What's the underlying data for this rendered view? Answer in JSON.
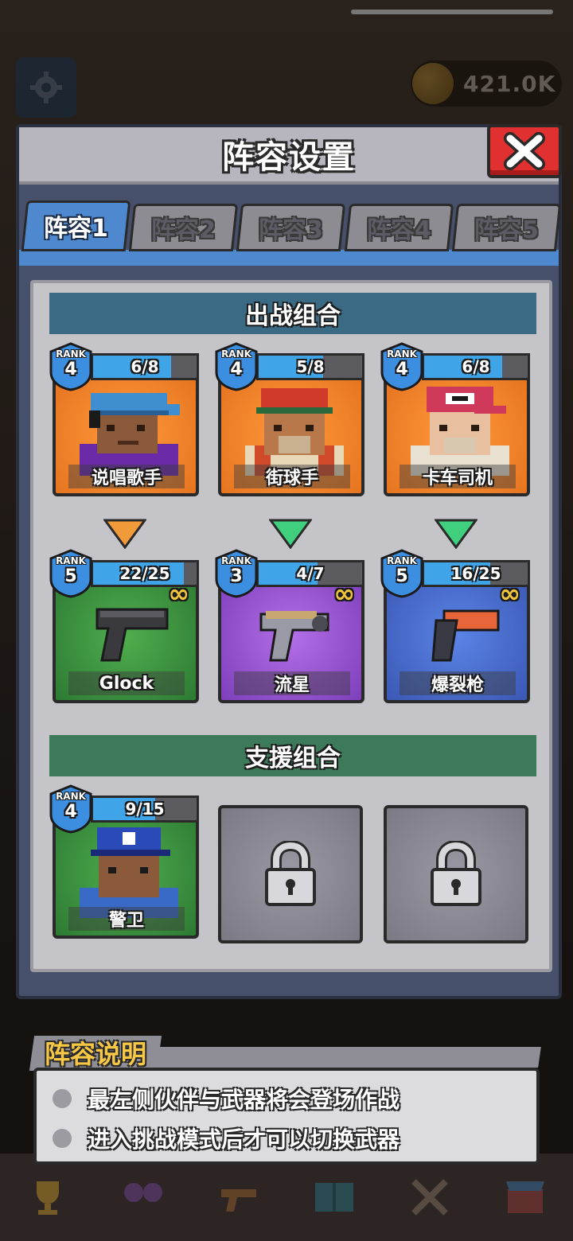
{
  "background": {
    "coin_amount": "421.0K"
  },
  "modal": {
    "title": "阵容设置",
    "tabs": [
      {
        "label": "阵容1",
        "active": true
      },
      {
        "label": "阵容2",
        "active": false
      },
      {
        "label": "阵容3",
        "active": false
      },
      {
        "label": "阵容4",
        "active": false
      },
      {
        "label": "阵容5",
        "active": false
      }
    ],
    "battle_section": {
      "title": "出战组合",
      "companions": [
        {
          "name": "说唱歌手",
          "rank_label": "RANK",
          "rank": "4",
          "progress": "6/8",
          "progress_fraction": 0.75,
          "color": "#e4711d"
        },
        {
          "name": "街球手",
          "rank_label": "RANK",
          "rank": "4",
          "progress": "5/8",
          "progress_fraction": 0.625,
          "color": "#e4711d"
        },
        {
          "name": "卡车司机",
          "rank_label": "RANK",
          "rank": "4",
          "progress": "6/8",
          "progress_fraction": 0.75,
          "color": "#e4711d"
        }
      ],
      "arrows": [
        {
          "color": "#f09a3a"
        },
        {
          "color": "#3fcf7d"
        },
        {
          "color": "#3fcf7d"
        }
      ],
      "weapons": [
        {
          "name": "Glock",
          "rank_label": "RANK",
          "rank": "5",
          "progress": "22/25",
          "progress_fraction": 0.88,
          "ammo": "∞",
          "color": "#2d7a33"
        },
        {
          "name": "流星",
          "rank_label": "RANK",
          "rank": "3",
          "progress": "4/7",
          "progress_fraction": 0.571,
          "ammo": "∞",
          "color": "#7e3fbb"
        },
        {
          "name": "爆裂枪",
          "rank_label": "RANK",
          "rank": "5",
          "progress": "16/25",
          "progress_fraction": 0.64,
          "ammo": "∞",
          "color": "#3b58b4"
        }
      ]
    },
    "support_section": {
      "title": "支援组合",
      "slots": [
        {
          "name": "警卫",
          "rank_label": "RANK",
          "rank": "4",
          "progress": "9/15",
          "progress_fraction": 0.6,
          "locked": false
        },
        {
          "locked": true
        },
        {
          "locked": true
        }
      ]
    }
  },
  "info": {
    "title": "阵容说明",
    "lines": [
      "最左侧伙伴与武器将会登场作战",
      "进入挑战模式后才可以切换武器"
    ]
  },
  "colors": {
    "accent_blue": "#4e89d0",
    "close_red": "#e03030",
    "info_title_yellow": "#f7c746"
  }
}
